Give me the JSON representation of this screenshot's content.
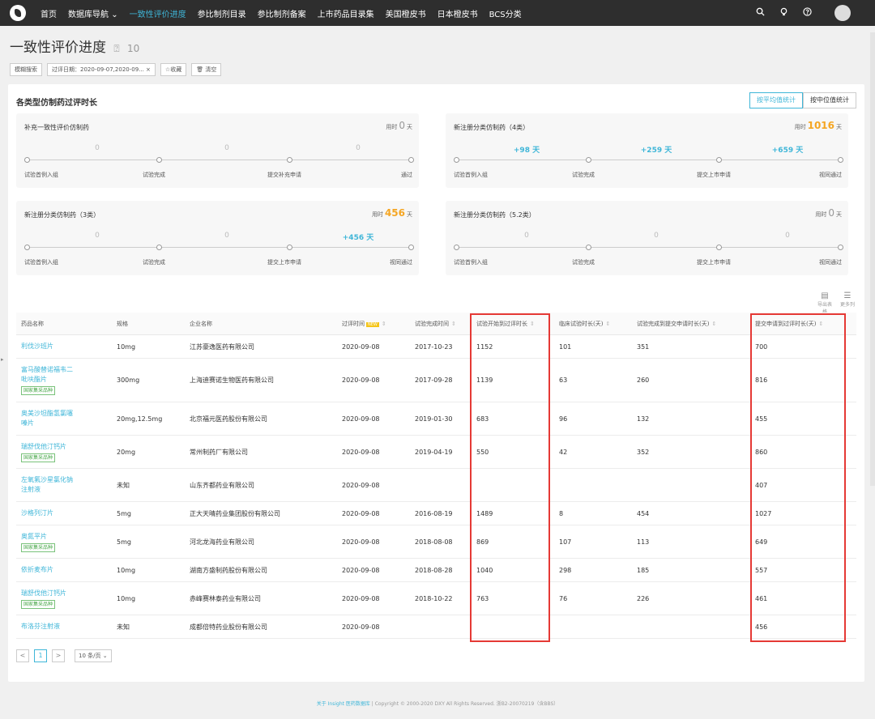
{
  "nav": {
    "items": [
      "首页",
      "数据库导航",
      "一致性评价进度",
      "参比制剂目录",
      "参比制剂备案",
      "上市药品目录集",
      "美国橙皮书",
      "日本橙皮书",
      "BCS分类"
    ],
    "nav_dropdown": "⌄"
  },
  "page": {
    "title": "一致性评价进度",
    "count": "10"
  },
  "filters": {
    "fuzzy": "模糊搜索",
    "date": "过评日期：2020-09-07,2020-09... ×",
    "favorite": "☆收藏",
    "clear": "🗑 清空"
  },
  "stats": {
    "title": "各类型仿制药过评时长",
    "toggle_avg": "按平均值统计",
    "toggle_median": "按中位值统计",
    "cards": [
      {
        "title": "补充一致性评价仿制药",
        "total_prefix": "用时",
        "total": "0",
        "total_unit": "天",
        "hot": false,
        "segments": [
          "0",
          "0",
          "0"
        ],
        "seg_hl": [
          false,
          false,
          false
        ],
        "stages": [
          "试验首例入组",
          "试验完成",
          "提交补充申请",
          "通过"
        ]
      },
      {
        "title": "新注册分类仿制药（4类）",
        "total_prefix": "用时",
        "total": "1016",
        "total_unit": "天",
        "hot": true,
        "segments": [
          "+98 天",
          "+259 天",
          "+659 天"
        ],
        "seg_hl": [
          true,
          true,
          true
        ],
        "stages": [
          "试验首例入组",
          "试验完成",
          "提交上市申请",
          "视同通过"
        ]
      },
      {
        "title": "新注册分类仿制药（3类）",
        "total_prefix": "用时",
        "total": "456",
        "total_unit": "天",
        "hot": true,
        "segments": [
          "0",
          "0",
          "+456 天"
        ],
        "seg_hl": [
          false,
          false,
          true
        ],
        "stages": [
          "试验首例入组",
          "试验完成",
          "提交上市申请",
          "视同通过"
        ]
      },
      {
        "title": "新注册分类仿制药（5.2类）",
        "total_prefix": "用时",
        "total": "0",
        "total_unit": "天",
        "hot": false,
        "segments": [
          "0",
          "0",
          "0"
        ],
        "seg_hl": [
          false,
          false,
          false
        ],
        "stages": [
          "试验首例入组",
          "试验完成",
          "提交上市申请",
          "视同通过"
        ]
      }
    ]
  },
  "export": {
    "export_label": "导出表格",
    "more_label": "更多列"
  },
  "table": {
    "headers": [
      "药品名称",
      "规格",
      "企业名称",
      "过评时间",
      "试验完成时间",
      "试验开始到过评时长",
      "临床试验时长(天)",
      "试验完成到提交申请时长(天)",
      "提交申请到过评时长(天)"
    ],
    "new_badge": "NEW",
    "sort_glyph": "⇕",
    "rows": [
      {
        "name": [
          "利伐沙班片"
        ],
        "tag": "",
        "spec": "10mg",
        "company": "江苏豪逸医药有限公司",
        "date": "2020-09-08",
        "done": "2017-10-23",
        "a": "1152",
        "b": "101",
        "c": "351",
        "d": "700"
      },
      {
        "name": [
          "富马酸替诺福韦二",
          "吡呋酯片"
        ],
        "tag": "国家集采品种",
        "spec": "300mg",
        "company": "上海迪赛诺生物医药有限公司",
        "date": "2020-09-08",
        "done": "2017-09-28",
        "a": "1139",
        "b": "63",
        "c": "260",
        "d": "816"
      },
      {
        "name": [
          "奥美沙坦酯氢氯噻",
          "嗪片"
        ],
        "tag": "",
        "spec": "20mg,12.5mg",
        "company": "北京福元医药股份有限公司",
        "date": "2020-09-08",
        "done": "2019-01-30",
        "a": "683",
        "b": "96",
        "c": "132",
        "d": "455"
      },
      {
        "name": [
          "瑞舒伐他汀钙片"
        ],
        "tag": "国家集采品种",
        "spec": "20mg",
        "company": "常州制药厂有限公司",
        "date": "2020-09-08",
        "done": "2019-04-19",
        "a": "550",
        "b": "42",
        "c": "352",
        "d": "860"
      },
      {
        "name": [
          "左氧氟沙星氯化钠",
          "注射液"
        ],
        "tag": "",
        "spec": "未知",
        "company": "山东齐都药业有限公司",
        "date": "2020-09-08",
        "done": "",
        "a": "",
        "b": "",
        "c": "",
        "d": "407"
      },
      {
        "name": [
          "沙格列汀片"
        ],
        "tag": "",
        "spec": "5mg",
        "company": "正大天晴药业集团股份有限公司",
        "date": "2020-09-08",
        "done": "2016-08-19",
        "a": "1489",
        "b": "8",
        "c": "454",
        "d": "1027"
      },
      {
        "name": [
          "奥氮平片"
        ],
        "tag": "国家集采品种",
        "spec": "5mg",
        "company": "河北龙海药业有限公司",
        "date": "2020-09-08",
        "done": "2018-08-08",
        "a": "869",
        "b": "107",
        "c": "113",
        "d": "649"
      },
      {
        "name": [
          "依折麦布片"
        ],
        "tag": "",
        "spec": "10mg",
        "company": "湖南方盛制药股份有限公司",
        "date": "2020-09-08",
        "done": "2018-08-28",
        "a": "1040",
        "b": "298",
        "c": "185",
        "d": "557"
      },
      {
        "name": [
          "瑞舒伐他汀钙片"
        ],
        "tag": "国家集采品种",
        "spec": "10mg",
        "company": "赤峰赛林泰药业有限公司",
        "date": "2020-09-08",
        "done": "2018-10-22",
        "a": "763",
        "b": "76",
        "c": "226",
        "d": "461"
      },
      {
        "name": [
          "布洛芬注射液"
        ],
        "tag": "",
        "spec": "未知",
        "company": "成都倍特药业股份有限公司",
        "date": "2020-09-08",
        "done": "",
        "a": "",
        "b": "",
        "c": "",
        "d": "456"
      }
    ]
  },
  "pager": {
    "prev": "<",
    "current": "1",
    "next": ">",
    "size": "10 条/页"
  },
  "footer": {
    "link": "关于 Insight 医药数据库",
    "text": " | Copyright © 2000-2020 DXY All Rights Reserved. 浙B2-20070219（含BBS）"
  },
  "colors": {
    "accent": "#3fb6d8",
    "hot": "#f5a623",
    "highlight_box": "#e53935",
    "tag": "#4aa84b"
  }
}
